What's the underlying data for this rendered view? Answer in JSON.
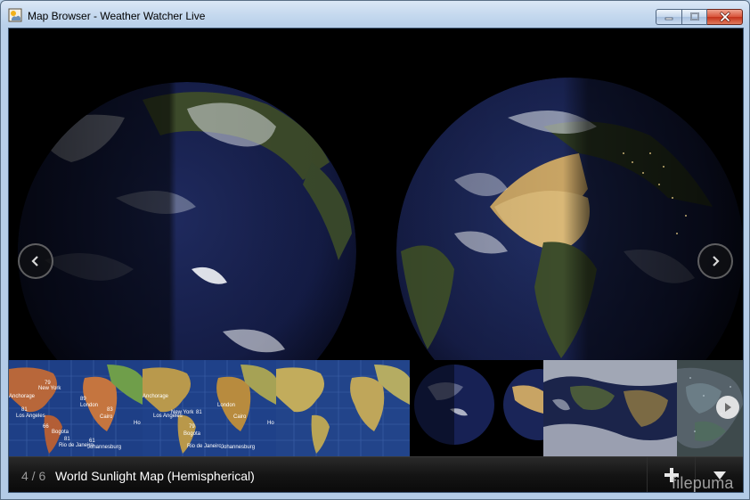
{
  "window": {
    "title": "Map Browser - Weather Watcher Live",
    "icon": "weather-app-icon",
    "controls": [
      "minimize-icon",
      "maximize-icon",
      "close-icon"
    ]
  },
  "viewer": {
    "image": "world-sunlight-hemispheres",
    "prev_icon": "chevron-left-icon",
    "next_icon": "chevron-right-icon"
  },
  "thumbnails": [
    {
      "id": "temperature-map-1",
      "labels": [
        {
          "text": "Anchorage"
        },
        {
          "text": "79"
        },
        {
          "text": "New York"
        },
        {
          "text": "89"
        },
        {
          "text": "London"
        },
        {
          "text": "81"
        },
        {
          "text": "Los Angeles"
        },
        {
          "text": "Cairo"
        },
        {
          "text": "66"
        },
        {
          "text": "Bogota"
        },
        {
          "text": "81"
        },
        {
          "text": "Rio de Janeiro"
        },
        {
          "text": "61"
        },
        {
          "text": "Johannesburg"
        },
        {
          "text": "83"
        },
        {
          "text": "Ho"
        }
      ]
    },
    {
      "id": "temperature-map-2",
      "labels": [
        {
          "text": "Anchorage"
        },
        {
          "text": "81"
        },
        {
          "text": "London"
        },
        {
          "text": "New York"
        },
        {
          "text": "Los Angeles"
        },
        {
          "text": "Cairo"
        },
        {
          "text": "79"
        },
        {
          "text": "Bogota"
        },
        {
          "text": "Rio de Janeiro"
        },
        {
          "text": "Johannesburg"
        },
        {
          "text": "Ho"
        }
      ]
    },
    {
      "id": "temperature-map-3",
      "labels": []
    },
    {
      "id": "hemisphere-globes",
      "labels": []
    },
    {
      "id": "satellite-map",
      "labels": []
    },
    {
      "id": "radar-map",
      "labels": [],
      "play_icon": "play-icon"
    }
  ],
  "bottombar": {
    "counter": "4 / 6",
    "caption": "World Sunlight Map (Hemispherical)",
    "add_icon": "plus-icon",
    "menu_icon": "triangle-down-icon",
    "watermark": "filepuma"
  },
  "colors": {
    "window_frame": "#b9d0ea",
    "close_button": "#c3321a",
    "viewer_bg": "#000000",
    "ocean_dark": "#151c3e",
    "land_warm": "#c8a464",
    "bar_text": "#ffffff",
    "counter_text": "#9a9a9a"
  }
}
